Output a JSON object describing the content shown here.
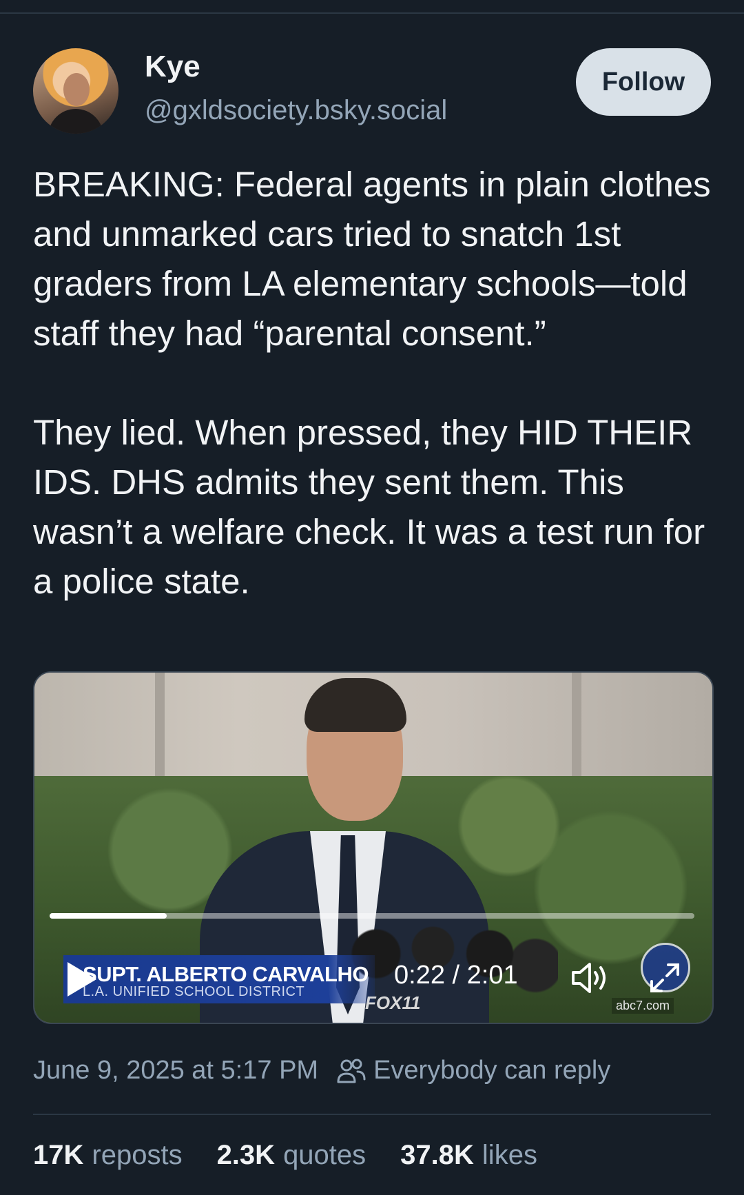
{
  "author": {
    "display_name": "Kye",
    "handle": "@gxldsociety.bsky.social"
  },
  "follow_label": "Follow",
  "post_text": "BREAKING: Federal agents in plain clothes and unmarked cars tried to snatch 1st graders from LA elementary schools—told staff they had “parental consent.”\n\nThey lied. When pressed, they HID THEIR IDS. DHS admits they sent them. This wasn’t a welfare check. It was a test run for a police state.",
  "video": {
    "lower_third_name": "SUPT. ALBERTO CARVALHO",
    "lower_third_org": "L.A. UNIFIED SCHOOL DISTRICT",
    "time_display": "0:22 / 2:01",
    "progress_fraction": 0.182,
    "fox_tag": "FOX11",
    "watermark": "abc7.com",
    "icons": [
      "play-icon",
      "volume-icon",
      "fullscreen-icon"
    ]
  },
  "meta": {
    "timestamp": "June 9, 2025 at 5:17 PM",
    "reply_setting": "Everybody can reply"
  },
  "stats": {
    "reposts_count": "17K",
    "reposts_label": "reposts",
    "quotes_count": "2.3K",
    "quotes_label": "quotes",
    "likes_count": "37.8K",
    "likes_label": "likes"
  },
  "colors": {
    "background": "#161e27",
    "text_primary": "#f1f3f5",
    "text_secondary": "#93a5b7",
    "follow_bg": "#d9e1e8"
  }
}
